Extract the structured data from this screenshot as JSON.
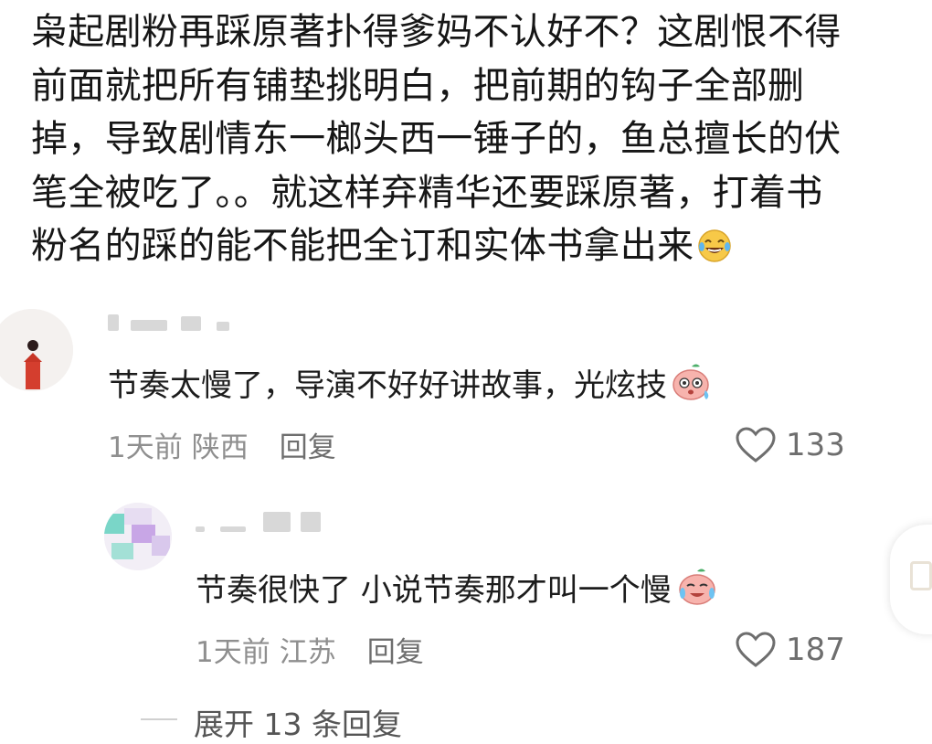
{
  "post": {
    "lines": [
      "枭起剧粉再踩原著扑得爹妈不认好不？这剧恨不得",
      "前面就把所有铺垫挑明白，把前期的钩子全部删",
      "掉，导致剧情东一榔头西一锤子的，鱼总擅长的伏",
      "笔全被吃了。。就这样弃精华还要踩原著，打着书",
      "粉名的踩的能不能把全订和实体书拿出来"
    ],
    "emoji_icon": "laughing-tears-emoji"
  },
  "comments": [
    {
      "text": "节奏太慢了，导演不好好讲故事，光炫技",
      "emoji_icon": "sweating-peach-emoji",
      "time": "1天前",
      "location": "陕西",
      "reply_label": "回复",
      "likes": "133"
    },
    {
      "text": "节奏很快了 小说节奏那才叫一个慢",
      "emoji_icon": "crying-peach-emoji",
      "time": "1天前",
      "location": "江苏",
      "reply_label": "回复",
      "likes": "187"
    }
  ],
  "expand_label": "展开 13 条回复",
  "colors": {
    "text_primary": "#161616",
    "text_meta": "#8f8f8f",
    "heart": "#6e6e6e"
  }
}
